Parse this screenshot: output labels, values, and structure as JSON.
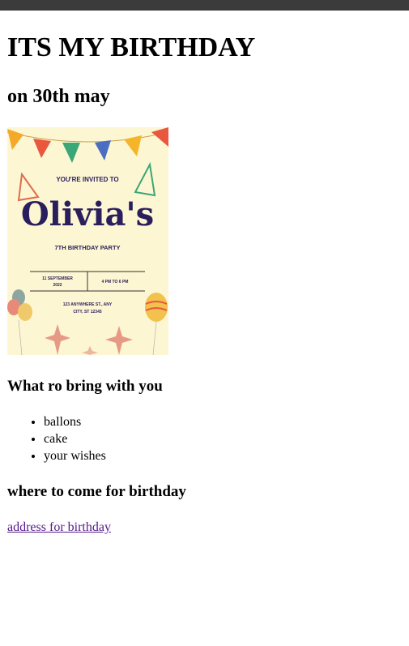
{
  "page": {
    "heading": "ITS MY BIRTHDAY",
    "subheading": "on 30th may"
  },
  "invitation": {
    "line1": "YOU'RE INVITED TO",
    "name": "Olivia's",
    "party": "7TH BIRTHDAY PARTY",
    "date_line1": "11 SEPTEMBER",
    "date_line2": "2022",
    "time": "4 PM TO 6 PM",
    "address_line1": "123 ANYWHERE ST., ANY",
    "address_line2": "CITY, ST 12345"
  },
  "bring": {
    "title": "What ro bring with you",
    "items": [
      "ballons",
      "cake",
      "your wishes"
    ]
  },
  "where": {
    "title": "where to come for birthday",
    "link_text": "address for birthday"
  },
  "colors": {
    "topbar": "#3b3b3b",
    "link_visited": "#551a8b",
    "card_bg": "#fdf6d3",
    "name_color": "#2a1f5c"
  }
}
